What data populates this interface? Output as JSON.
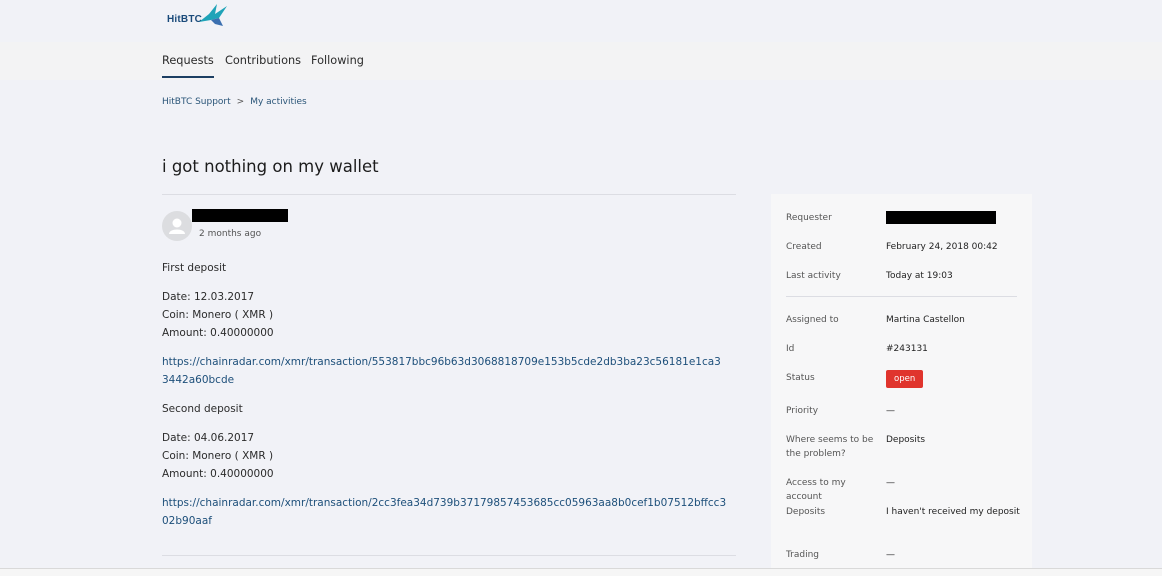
{
  "brand": {
    "logo_text": "HitBTC"
  },
  "nav": {
    "tabs": [
      "Requests",
      "Contributions",
      "Following"
    ],
    "active": 0
  },
  "breadcrumb": {
    "items": [
      "HitBTC Support",
      "My activities"
    ],
    "separator": ">"
  },
  "request": {
    "title": "i got nothing on my wallet",
    "time": "2 months ago",
    "body": {
      "p1": "First deposit",
      "p2": [
        "Date: 12.03.2017",
        "Coin: Monero ( XMR )",
        "Amount: 0.40000000"
      ],
      "link1": "https://chainradar.com/xmr/transaction/553817bbc96b63d3068818709e153b5cde2db3ba23c56181e1ca33442a60bcde",
      "p3": "Second deposit",
      "p4": [
        "Date: 04.06.2017",
        "Coin: Monero ( XMR )",
        "Amount: 0.40000000"
      ],
      "link2": "https://chainradar.com/xmr/transaction/2cc3fea34d739b37179857453685cc05963aa8b0cef1b07512bffcc302b90aaf"
    }
  },
  "details": {
    "requester_label": "Requester",
    "created_label": "Created",
    "created": "February 24, 2018 00:42",
    "last_activity_label": "Last activity",
    "last_activity": "Today at 19:03",
    "assigned_label": "Assigned to",
    "assigned": "Martina Castellon",
    "id_label": "Id",
    "id": "#243131",
    "status_label": "Status",
    "status": "open",
    "priority_label": "Priority",
    "priority": "—",
    "problem_label": "Where seems to be the problem?",
    "problem": "Deposits",
    "access_label": "Access to my account",
    "access": "—",
    "deposits_label": "Deposits",
    "deposits": "I haven't received my deposit",
    "trading_label": "Trading",
    "trading": "—"
  },
  "colors": {
    "accent": "#1d3f62",
    "link": "#1d4f7a",
    "status_open": "#e0342d",
    "logo_teal": "#1fa3b8"
  }
}
